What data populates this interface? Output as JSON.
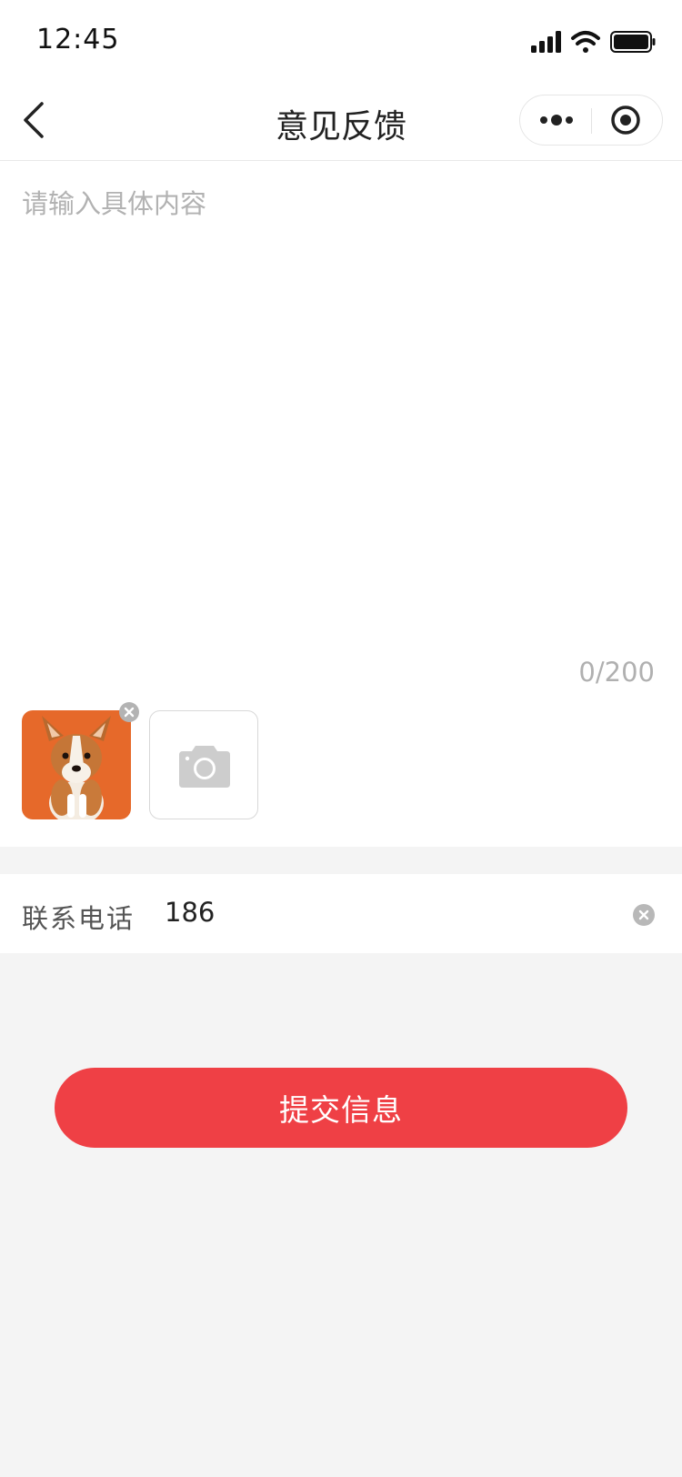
{
  "status_bar": {
    "time": "12:45",
    "icons": [
      "signal-icon",
      "wifi-icon",
      "battery-icon"
    ]
  },
  "nav": {
    "title": "意见反馈",
    "back_icon": "chevron-left-icon",
    "more_icon": "more-dots-icon",
    "close_icon": "target-circle-icon"
  },
  "feedback": {
    "placeholder": "请输入具体内容",
    "value": "",
    "char_count": "0/200",
    "photos": [
      {
        "icon": "corgi-photo",
        "bg": "#e6692a"
      }
    ],
    "upload_icon": "camera-icon"
  },
  "phone": {
    "label": "联系电话",
    "value": "186",
    "clear_icon": "clear-circle-icon"
  },
  "submit": {
    "label": "提交信息"
  },
  "colors": {
    "accent": "#ef4045",
    "page_bg": "#f4f4f4",
    "placeholder": "#b2b2b2"
  }
}
